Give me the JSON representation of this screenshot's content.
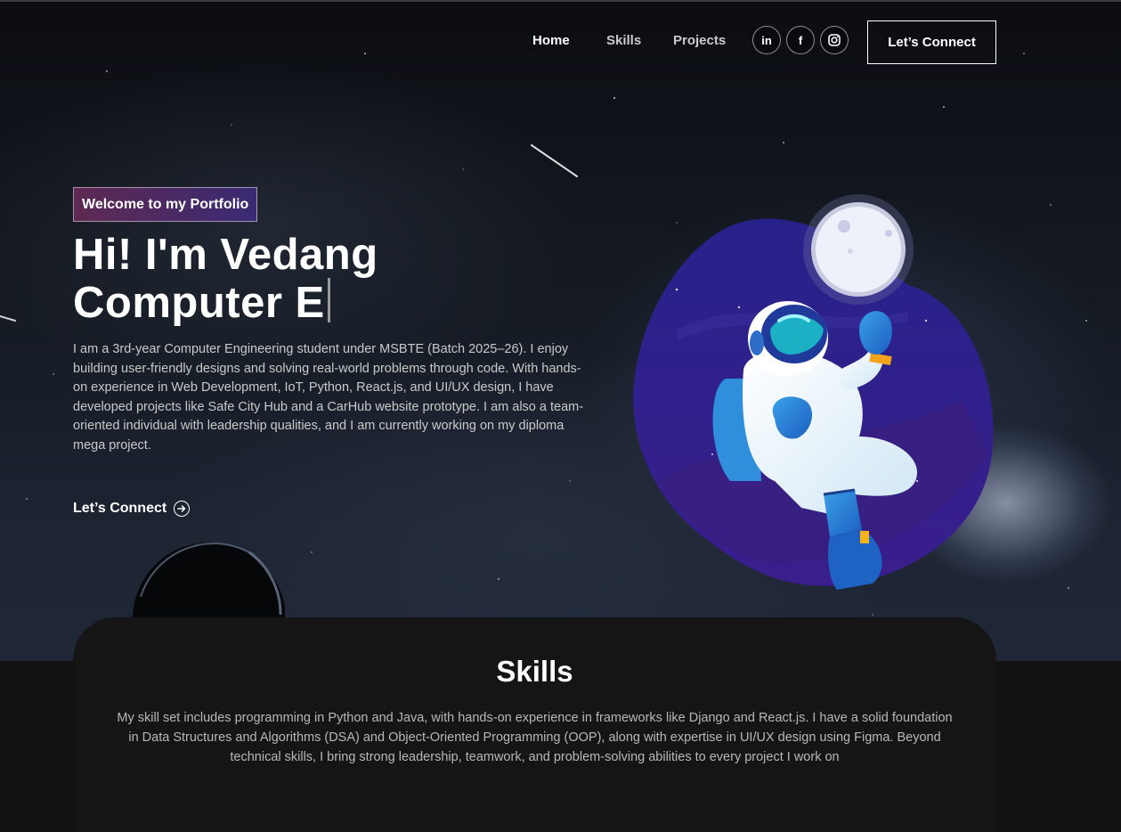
{
  "nav": {
    "links": [
      "Home",
      "Skills",
      "Projects"
    ],
    "socials": [
      {
        "icon": "linkedin-icon",
        "glyph": "in"
      },
      {
        "icon": "facebook-icon",
        "glyph": "f"
      },
      {
        "icon": "instagram-icon",
        "glyph": ""
      }
    ],
    "connect_label": "Let’s Connect"
  },
  "hero": {
    "tagline": "Welcome to my Portfolio",
    "title_line1": "Hi! I'm Vedang",
    "title_line2": "Computer E",
    "description": "I am a 3rd-year Computer Engineering student under MSBTE (Batch 2025–26). I enjoy building user-friendly designs and solving real-world problems through code. With hands-on experience in Web Development, IoT, Python, React.js, and UI/UX design, I have developed projects like Safe City Hub and a CarHub website prototype. I am also a team-oriented individual with leadership qualities, and I am currently working on my diploma mega project.",
    "cta_label": "Let’s Connect"
  },
  "skills": {
    "title": "Skills",
    "description": "My skill set includes programming in Python and Java, with hands-on experience in frameworks like Django and React.js. I have a solid foundation in Data Structures and Algorithms (DSA) and Object-Oriented Programming (OOP), along with expertise in UI/UX design using Figma. Beyond technical skills, I bring strong leadership, teamwork, and problem-solving abilities to every project I work on"
  },
  "colors": {
    "background": "#121212",
    "tagline_gradient_start": "#aa367c",
    "tagline_gradient_end": "#4a2fbd",
    "blob": "#2b1f86",
    "card": "#151515"
  }
}
